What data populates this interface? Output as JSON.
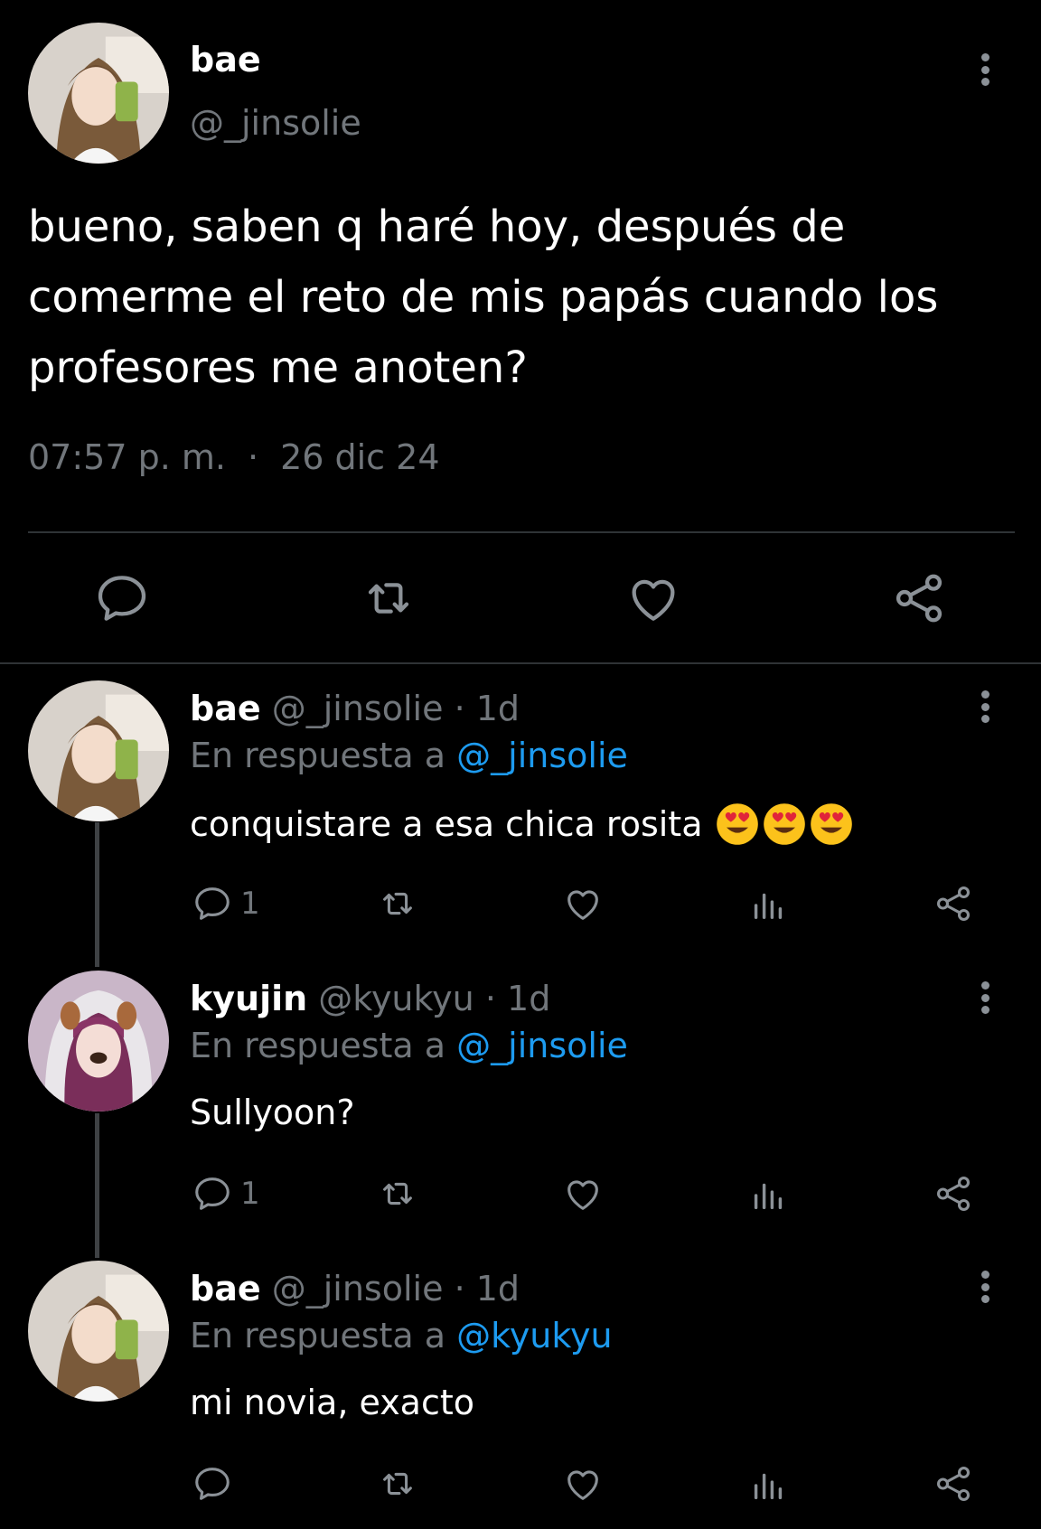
{
  "main_tweet": {
    "name": "bae",
    "handle": "@_jinsolie",
    "text": "bueno, saben q haré hoy, después de comerme el reto de mis papás cuando los profesores me anoten?",
    "time": "07:57 p. m.",
    "separator": "·",
    "date": "26 dic 24",
    "actions": [
      "reply-icon",
      "retweet-icon",
      "like-icon",
      "share-icon"
    ]
  },
  "replies": [
    {
      "name": "bae",
      "handle": "@_jinsolie",
      "separator": "·",
      "time": "1d",
      "reply_prefix": "En respuesta a",
      "reply_to": "@_jinsolie",
      "text": "conquistare a esa chica rosita",
      "emojis": [
        "heart-eyes-emoji",
        "heart-eyes-emoji",
        "heart-eyes-emoji"
      ],
      "reply_count": "1"
    },
    {
      "name": "kyujin",
      "handle": "@kyukyu",
      "separator": "·",
      "time": "1d",
      "reply_prefix": "En respuesta a",
      "reply_to": "@_jinsolie",
      "text": "Sullyoon?",
      "reply_count": "1"
    },
    {
      "name": "bae",
      "handle": "@_jinsolie",
      "separator": "·",
      "time": "1d",
      "reply_prefix": "En respuesta a",
      "reply_to": "@kyukyu",
      "text": "mi novia, exacto",
      "reply_count": ""
    }
  ],
  "colors": {
    "background": "#000000",
    "text": "#ffffff",
    "secondary": "#71767b",
    "mention": "#1d9bf0",
    "divider": "#2f3336"
  }
}
